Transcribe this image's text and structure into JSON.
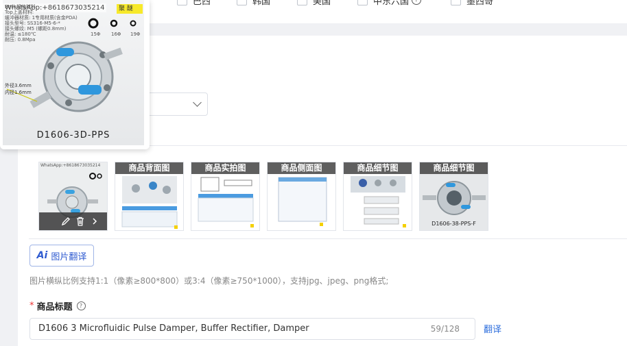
{
  "countries": [
    "巴西",
    "韩国",
    "美国",
    "中东六国",
    "墨西哥"
  ],
  "popup": {
    "watermark": "WhatsApp:+8618673035214",
    "highlight": "聚 醚",
    "specs": [
      "Rosh规格材料",
      "Top上盖材料:",
      "缓冲器材质: 1专用材质(含金PDA)",
      "接头型号: SS316-M5-6-*",
      "接头螺纹: M5 (螺距0.8mm)",
      "耐温: ≤180℃",
      "耐压: 0.8Mpa"
    ],
    "dims": [
      "15Φ",
      "16Φ",
      "19Φ"
    ],
    "side_label": "外径3.6mm\n内径1.6mm",
    "model": "D1606-3D-PPS"
  },
  "thumbnails": [
    {
      "caption": "",
      "kind": "main"
    },
    {
      "caption": "商品背面图",
      "kind": "doc"
    },
    {
      "caption": "商品实拍图",
      "kind": "doc"
    },
    {
      "caption": "商品侧面图",
      "kind": "doc"
    },
    {
      "caption": "商品细节图",
      "kind": "doc"
    },
    {
      "caption": "商品细节图",
      "kind": "photo",
      "model": "D1606-38-PPS-F"
    }
  ],
  "thumb_main_watermark": "WhatsApp:+8618673035214",
  "ai_translate_label": "图片翻译",
  "ai_icon_text": "Ai",
  "image_hint": "图片横纵比例支持1:1（像素≥800*800）或3:4（像素≥750*1000），支持jpg、jpeg、png格式;",
  "title_field": {
    "label": "商品标题",
    "required_mark": "*",
    "value": "D1606 3 Microfluidic Pulse Damper, Buffer Rectifier, Damper",
    "counter": "59/128"
  },
  "translate_link": "翻译",
  "colors": {
    "accent": "#2f6fdd",
    "required": "#e33333"
  }
}
